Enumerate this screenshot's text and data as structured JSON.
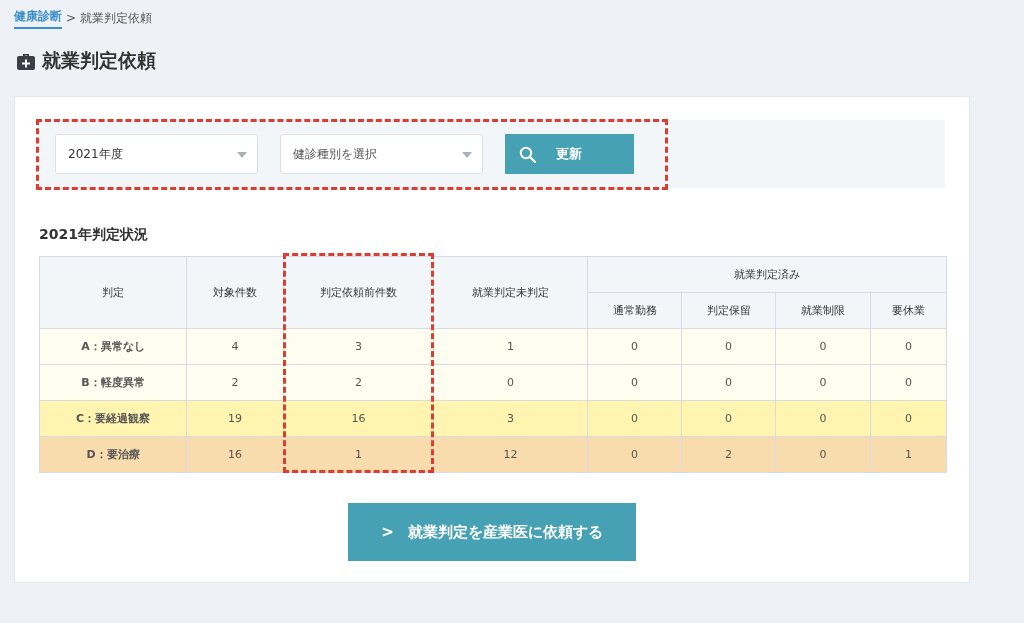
{
  "breadcrumb": [
    {
      "label": "健康診断",
      "kind": "link"
    },
    {
      "label": ">",
      "kind": "separator"
    },
    {
      "label": "就業判定依頼",
      "kind": "current"
    }
  ],
  "title": "就業判定依頼",
  "filters": {
    "highlighted": true,
    "year_select": {
      "value": "2021年度"
    },
    "type_select": {
      "placeholder": "健診種別を選択"
    },
    "update_button": "更新"
  },
  "section_title": "2021年判定状況",
  "table": {
    "columns": [
      {
        "label": "判定",
        "highlighted": false
      },
      {
        "label": "対象件数",
        "highlighted": false
      },
      {
        "label": "判定依頼前件数",
        "highlighted": true
      },
      {
        "label": "就業判定未判定",
        "highlighted": false
      },
      {
        "label": "就業判定済み",
        "highlighted": false,
        "colspan": 4,
        "children": [
          "通常勤務",
          "判定保留",
          "就業制限",
          "要休業"
        ]
      }
    ],
    "rows": [
      {
        "color": "#fffdf0",
        "cells": [
          "A：異常なし",
          "4",
          "3",
          "1",
          "0",
          "0",
          "0",
          "0"
        ]
      },
      {
        "color": "#fffdf0",
        "cells": [
          "B：軽度異常",
          "2",
          "2",
          "0",
          "0",
          "0",
          "0",
          "0"
        ]
      },
      {
        "color": "#fff5b1",
        "cells": [
          "C：要経過観察",
          "19",
          "16",
          "3",
          "0",
          "0",
          "0",
          "0"
        ]
      },
      {
        "color": "#f9dcae",
        "cells": [
          "D：要治療",
          "16",
          "1",
          "12",
          "0",
          "2",
          "0",
          "1"
        ]
      }
    ]
  },
  "request_button": {
    "chevron": ">",
    "label": "就業判定を産業医に依頼する"
  }
}
